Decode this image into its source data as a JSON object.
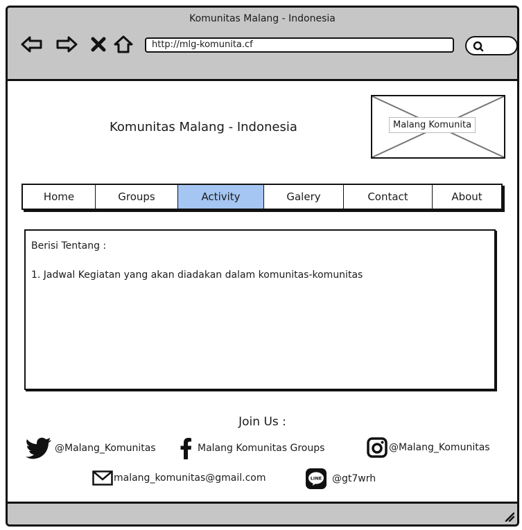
{
  "window": {
    "title": "Komunitas Malang - Indonesia"
  },
  "browser": {
    "url": "http://mlg-komunita.cf"
  },
  "site": {
    "title": "Komunitas Malang - Indonesia",
    "logo_label": "Malang Komunita"
  },
  "menu": {
    "active_color": "#a5c5f2",
    "items": [
      {
        "label": "Home"
      },
      {
        "label": "Groups"
      },
      {
        "label": "Activity"
      },
      {
        "label": "Galery"
      },
      {
        "label": "Contact"
      },
      {
        "label": "About"
      }
    ]
  },
  "content": {
    "heading": "Berisi Tentang :",
    "line1": "1. Jadwal Kegiatan yang akan diadakan dalam komunitas-komunitas"
  },
  "footer": {
    "join_label": "Join Us :",
    "twitter": "@Malang_Komunitas",
    "facebook": "Malang Komunitas Groups",
    "instagram": "@Malang_Komunitas",
    "email": "malang_komunitas@gmail.com",
    "line": "@gt7wrh"
  }
}
